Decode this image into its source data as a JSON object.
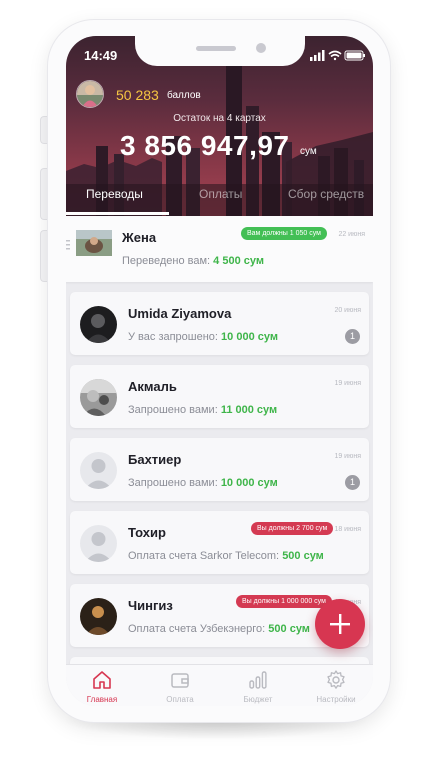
{
  "status": {
    "time": "14:49"
  },
  "header": {
    "points_value": "50 283",
    "points_label": "баллов",
    "balance_caption": "Остаток на 4 картах",
    "balance": "3 856 947,97",
    "currency": "сум"
  },
  "tabs": [
    {
      "label": "Переводы",
      "active": true
    },
    {
      "label": "Оплаты",
      "active": false
    },
    {
      "label": "Сбор средств",
      "active": false
    }
  ],
  "transactions": [
    {
      "name": "Жена",
      "date": "22 июня",
      "badge": "Вам должны 1 050 сум",
      "badge_color": "#43bf55",
      "prefix": "Переведено вам:",
      "amount": "4 500 сум",
      "avatar": "photo"
    },
    {
      "name": "Umida Ziyamova",
      "date": "20 июня",
      "count": "1",
      "prefix": "У вас запрошено:",
      "amount": "10 000 сум",
      "avatar": "photo-dark"
    },
    {
      "name": "Акмаль",
      "date": "19 июня",
      "prefix": "Запрошено вами:",
      "amount": "11 000 сум",
      "avatar": "photo-bw"
    },
    {
      "name": "Бахтиер",
      "date": "19 июня",
      "count": "1",
      "prefix": "Запрошено вами:",
      "amount": "10 000 сум",
      "avatar": "placeholder"
    },
    {
      "name": "Тохир",
      "date": "18 июня",
      "badge": "Вы должны 2 700 сум",
      "badge_color": "#d43a52",
      "prefix": "Оплата счета Sarkor Telecom:",
      "amount": "500 сум",
      "avatar": "placeholder"
    },
    {
      "name": "Чингиз",
      "date": "17 июня",
      "badge": "Вы должны 1 000 000 сум",
      "badge_color": "#d43a52",
      "prefix": "Оплата счета Узбекэнерго:",
      "amount": "500 сум",
      "avatar": "photo-warm"
    }
  ],
  "bottom_nav": [
    {
      "label": "Главная",
      "icon": "home-icon",
      "active": true
    },
    {
      "label": "Оплата",
      "icon": "wallet-icon",
      "active": false
    },
    {
      "label": "Бюджет",
      "icon": "bar-chart-icon",
      "active": false
    },
    {
      "label": "Настройки",
      "icon": "gear-icon",
      "active": false
    }
  ],
  "colors": {
    "accent": "#d73651",
    "amount_green": "#3fb54a",
    "points_gold": "#f5c542"
  }
}
